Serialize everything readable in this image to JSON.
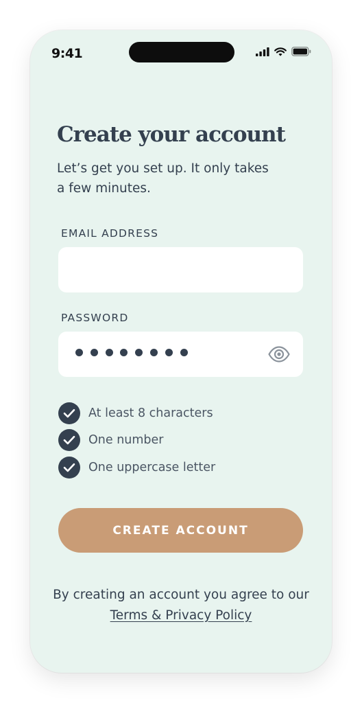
{
  "status_bar": {
    "time": "9:41",
    "icons": [
      "cellular-signal-icon",
      "wifi-icon",
      "battery-icon"
    ]
  },
  "header": {
    "title": "Create your account",
    "subtitle": "Let’s get you set up. It only takes a few minutes."
  },
  "form": {
    "email": {
      "label": "EMAIL ADDRESS",
      "value": "",
      "placeholder": ""
    },
    "password": {
      "label": "PASSWORD",
      "masked_length": 8,
      "visibility_icon": "eye-icon"
    },
    "requirements": [
      {
        "label": "At least 8 characters",
        "met": true
      },
      {
        "label": "One number",
        "met": true
      },
      {
        "label": "One uppercase letter",
        "met": true
      }
    ],
    "submit_label": "CREATE ACCOUNT"
  },
  "legal": {
    "prefix": "By creating an account you agree to our ",
    "link_text": "Terms & Privacy Policy"
  },
  "colors": {
    "background": "#e8f4ef",
    "text": "#34404f",
    "button": "#c99c76",
    "input_bg": "#ffffff"
  }
}
